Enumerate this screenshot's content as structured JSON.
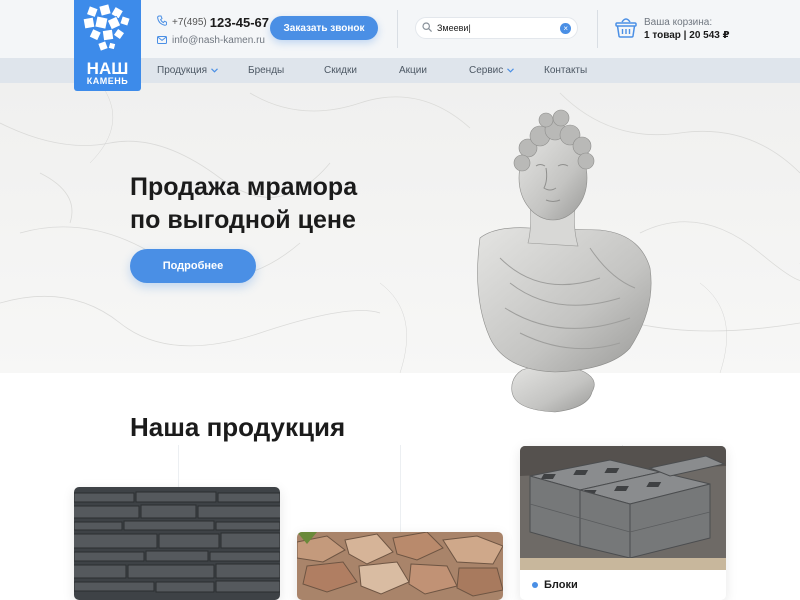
{
  "logo": {
    "line1": "НАШ",
    "line2": "КАМЕНЬ"
  },
  "header": {
    "phone_code": "+7(495)",
    "phone_number": "123-45-67",
    "email": "info@nash-kamen.ru",
    "callback_label": "Заказать звонок",
    "search_value": "Змееви|",
    "cart_label": "Ваша корзина:",
    "cart_summary": "1 товар | 20 543 ₽"
  },
  "nav": {
    "items": [
      {
        "label": "Продукция"
      },
      {
        "label": "Бренды"
      },
      {
        "label": "Скидки"
      },
      {
        "label": "Акции"
      },
      {
        "label": "Сервис"
      },
      {
        "label": "Контакты"
      }
    ]
  },
  "hero": {
    "title_line1": "Продажа мрамора",
    "title_line2": "по выгодной цене",
    "button_label": "Подробнее"
  },
  "products": {
    "title": "Наша продукция",
    "cards": [
      {
        "label": ""
      },
      {
        "label": ""
      },
      {
        "label": "Блоки"
      }
    ]
  },
  "colors": {
    "accent": "#4a8fe5",
    "logo": "#3d8bea",
    "nav_bg": "#dfe5ec"
  },
  "icons": [
    "phone-icon",
    "mail-icon",
    "search-icon",
    "clear-icon",
    "cart-icon",
    "chevron-down-icon"
  ]
}
